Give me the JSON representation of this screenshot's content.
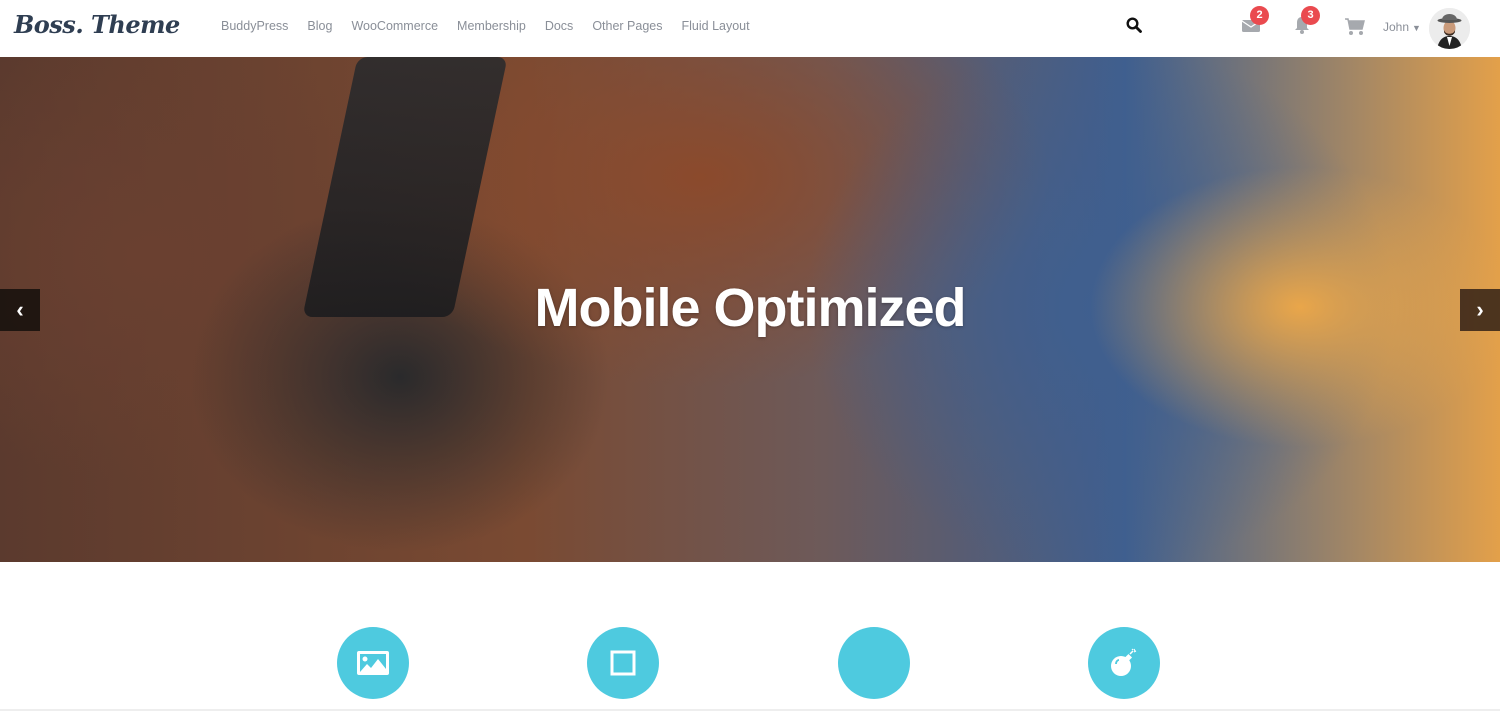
{
  "header": {
    "logo": "Boss. Theme",
    "nav": [
      "BuddyPress",
      "Blog",
      "WooCommerce",
      "Membership",
      "Docs",
      "Other Pages",
      "Fluid Layout"
    ],
    "messages_count": "2",
    "notifications_count": "3",
    "username": "John",
    "badge_color": "#ea4a4f"
  },
  "hero": {
    "title": "Mobile Optimized",
    "prev_label": "‹",
    "next_label": "›"
  },
  "features": {
    "accent_color": "#4ecadf",
    "icons": [
      "image-icon",
      "square-icon",
      "circle-icon",
      "bomb-icon"
    ]
  }
}
